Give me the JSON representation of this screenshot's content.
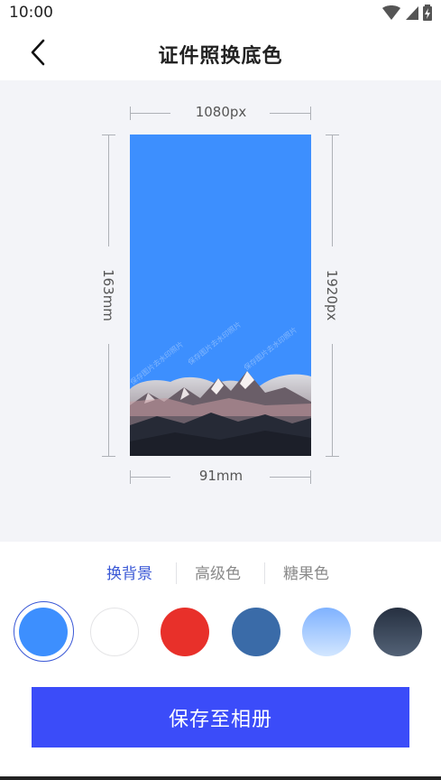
{
  "status_bar": {
    "time": "10:00"
  },
  "header": {
    "title": "证件照换底色"
  },
  "preview": {
    "width_px": "1080px",
    "height_px": "1920px",
    "width_mm": "91mm",
    "height_mm": "163mm",
    "watermark": "保存图片去水印照片",
    "background_color": "#3d8ffe"
  },
  "tabs": [
    {
      "label": "换背景",
      "active": true
    },
    {
      "label": "高级色",
      "active": false
    },
    {
      "label": "糖果色",
      "active": false
    }
  ],
  "swatches": [
    {
      "name": "blue",
      "color": "#3d8ffe",
      "selected": true
    },
    {
      "name": "white",
      "color": "#ffffff",
      "selected": false
    },
    {
      "name": "red",
      "color": "#e8302a",
      "selected": false
    },
    {
      "name": "dark-blue",
      "color": "#3a6ba8",
      "selected": false
    },
    {
      "name": "light-blue-gradient",
      "color": "#9ec6ff",
      "selected": false
    },
    {
      "name": "slate-gradient",
      "color": "#3c4a5c",
      "selected": false
    }
  ],
  "actions": {
    "save_label": "保存至相册"
  },
  "colors": {
    "accent": "#3a58d6",
    "button": "#3b4cf9",
    "preview_bg": "#f3f4f8"
  }
}
